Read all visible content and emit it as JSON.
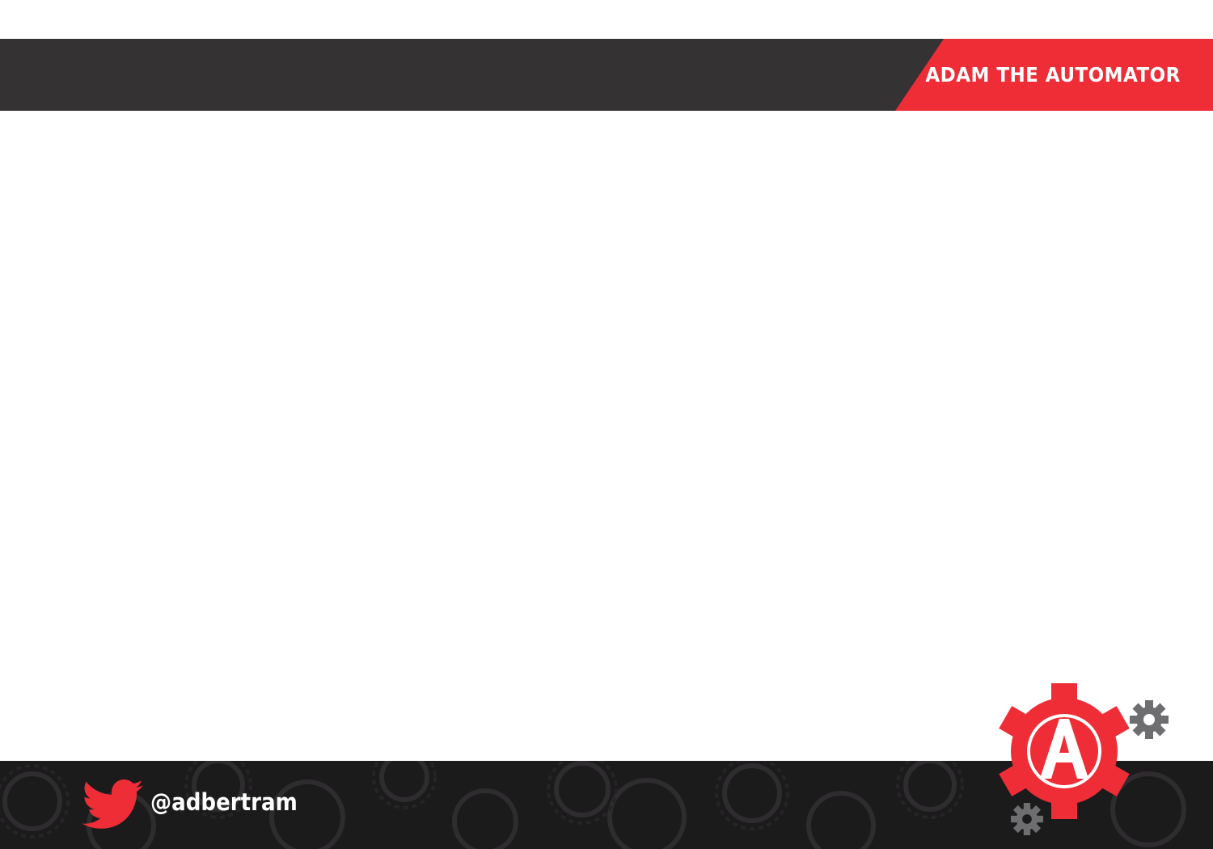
{
  "header": {
    "brand": "ADAM THE AUTOMATOR"
  },
  "footer": {
    "twitter_handle": "@adbertram"
  },
  "icons": {
    "twitter": "twitter-bird-icon",
    "logo": "gear-a-logo-icon",
    "small_gear_top": "gear-icon",
    "small_gear_bottom": "gear-icon"
  },
  "colors": {
    "header_dark": "#353234",
    "brand_red": "#ee2d37",
    "footer_dark": "#1c1b1c",
    "gear_gray": "#6e6e70",
    "text_white": "#ffffff"
  }
}
